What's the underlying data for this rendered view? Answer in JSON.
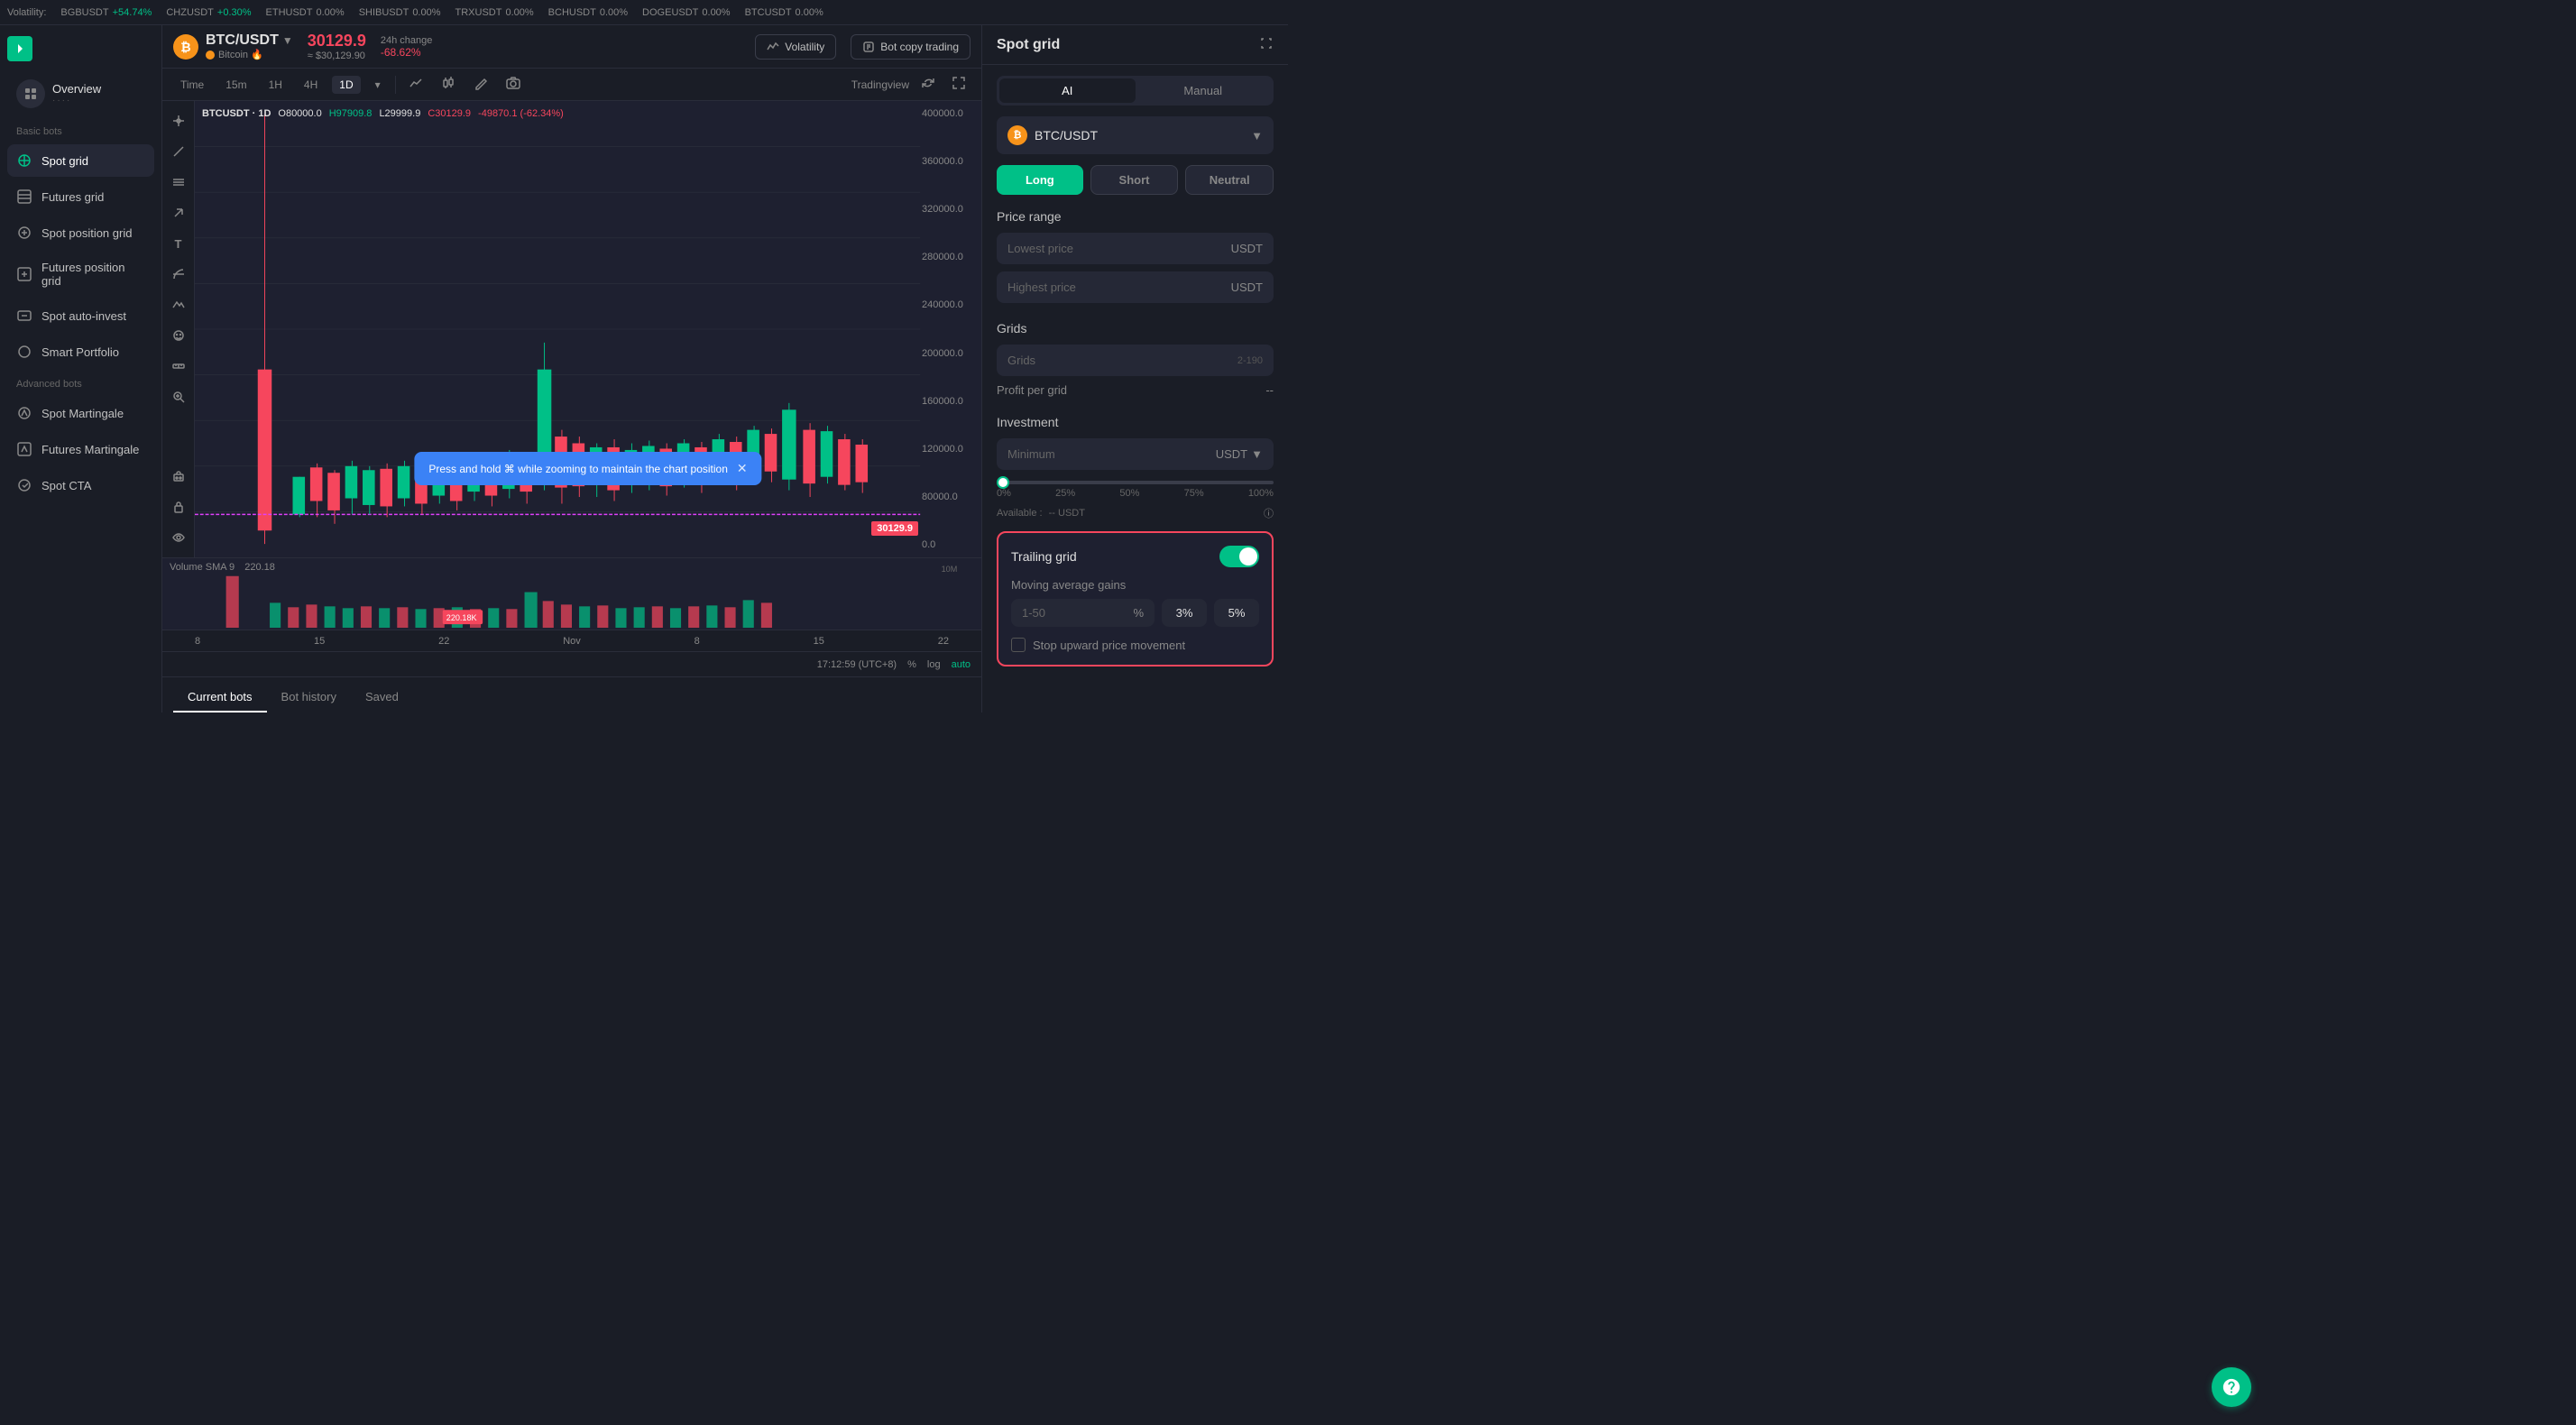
{
  "ticker": {
    "volatility_label": "Volatility:",
    "items": [
      {
        "symbol": "BGBUSDT",
        "change": "+54.74%",
        "dir": "up"
      },
      {
        "symbol": "CHZUSDT",
        "change": "+0.30%",
        "dir": "up"
      },
      {
        "symbol": "ETHUSDT",
        "change": "0.00%",
        "dir": "flat"
      },
      {
        "symbol": "SHIBUSDT",
        "change": "0.00%",
        "dir": "flat"
      },
      {
        "symbol": "TRXUSDT",
        "change": "0.00%",
        "dir": "flat"
      },
      {
        "symbol": "BCHUSDT",
        "change": "0.00%",
        "dir": "flat"
      },
      {
        "symbol": "DOGEUSDT",
        "change": "0.00%",
        "dir": "flat"
      },
      {
        "symbol": "BTCUSDT",
        "change": "0.00%",
        "dir": "flat"
      }
    ]
  },
  "sidebar": {
    "overview": {
      "name": "Overview",
      "dots": "····"
    },
    "basic_label": "Basic bots",
    "basic_items": [
      {
        "id": "spot-grid",
        "label": "Spot grid",
        "active": true
      },
      {
        "id": "futures-grid",
        "label": "Futures grid",
        "active": false
      },
      {
        "id": "spot-position-grid",
        "label": "Spot position grid",
        "active": false
      },
      {
        "id": "futures-position-grid",
        "label": "Futures position grid",
        "active": false
      },
      {
        "id": "spot-auto-invest",
        "label": "Spot auto-invest",
        "active": false
      },
      {
        "id": "smart-portfolio",
        "label": "Smart Portfolio",
        "active": false
      }
    ],
    "advanced_label": "Advanced bots",
    "advanced_items": [
      {
        "id": "spot-martingale",
        "label": "Spot Martingale",
        "active": false
      },
      {
        "id": "futures-martingale",
        "label": "Futures Martingale",
        "active": false
      },
      {
        "id": "spot-cta",
        "label": "Spot CTA",
        "active": false
      }
    ]
  },
  "chart": {
    "pair": "BTC/USDT",
    "pair_sub": "Bitcoin 🔥",
    "price": "30129.9",
    "price_usd": "≈ $30,129.90",
    "change_label": "24h change",
    "change_value": "-68.62%",
    "timeframes": [
      "Time",
      "15m",
      "1H",
      "4H",
      "1D"
    ],
    "active_tf": "1D",
    "ohlc": {
      "pair": "BTCUSDT · 1D",
      "o": "O80000.0",
      "h": "H97909.8",
      "l": "L29999.9",
      "c": "C30129.9",
      "chg": "-49870.1 (-62.34%)"
    },
    "price_levels": [
      "400000.0",
      "360000.0",
      "320000.0",
      "280000.0",
      "240000.0",
      "200000.0",
      "160000.0",
      "120000.0",
      "80000.0",
      "0.0"
    ],
    "current_price_badge": "30129.9",
    "tooltip_text": "Press and hold ⌘ while zooming to maintain the chart position",
    "time_labels": [
      "8",
      "15",
      "22",
      "Nov",
      "8",
      "15",
      "22"
    ],
    "volume_label": "Volume SMA 9",
    "volume_sma": "220.18",
    "volume_badge": "220.18K",
    "bottom_time": "17:12:59 (UTC+8)",
    "bottom_pct": "%",
    "bottom_log": "log",
    "bottom_auto": "auto",
    "volatility_btn": "Volatility",
    "bot_copy_btn": "Bot copy trading",
    "tradingview": "Tradingview"
  },
  "bot_tabs": {
    "tabs": [
      {
        "label": "Current bots",
        "active": true
      },
      {
        "label": "Bot history",
        "active": false
      },
      {
        "label": "Saved",
        "active": false
      }
    ]
  },
  "panel": {
    "title": "Spot grid",
    "mode_tabs": [
      {
        "label": "AI",
        "active": true
      },
      {
        "label": "Manual",
        "active": false
      }
    ],
    "pair": "BTC/USDT",
    "directions": [
      {
        "label": "Long",
        "type": "long"
      },
      {
        "label": "Short",
        "type": "short"
      },
      {
        "label": "Neutral",
        "type": "neutral"
      }
    ],
    "price_range": {
      "title": "Price range",
      "lowest_placeholder": "Lowest price",
      "lowest_unit": "USDT",
      "highest_placeholder": "Highest price",
      "highest_unit": "USDT"
    },
    "grids": {
      "title": "Grids",
      "placeholder": "Grids",
      "range": "2-190",
      "profit_label": "Profit per grid",
      "profit_value": "--"
    },
    "investment": {
      "title": "Investment",
      "placeholder": "Minimum",
      "unit": "USDT",
      "slider_labels": [
        "0%",
        "25%",
        "50%",
        "75%",
        "100%"
      ],
      "available_label": "Available :",
      "available_value": "-- USDT"
    },
    "trailing": {
      "label": "Trailing grid",
      "toggle_on": true,
      "ma_label": "Moving average gains",
      "ma_range": "1-50",
      "ma_pct": "%",
      "ma_val": "3%",
      "ma_5pct": "5%",
      "stop_label": "Stop upward price movement"
    }
  }
}
